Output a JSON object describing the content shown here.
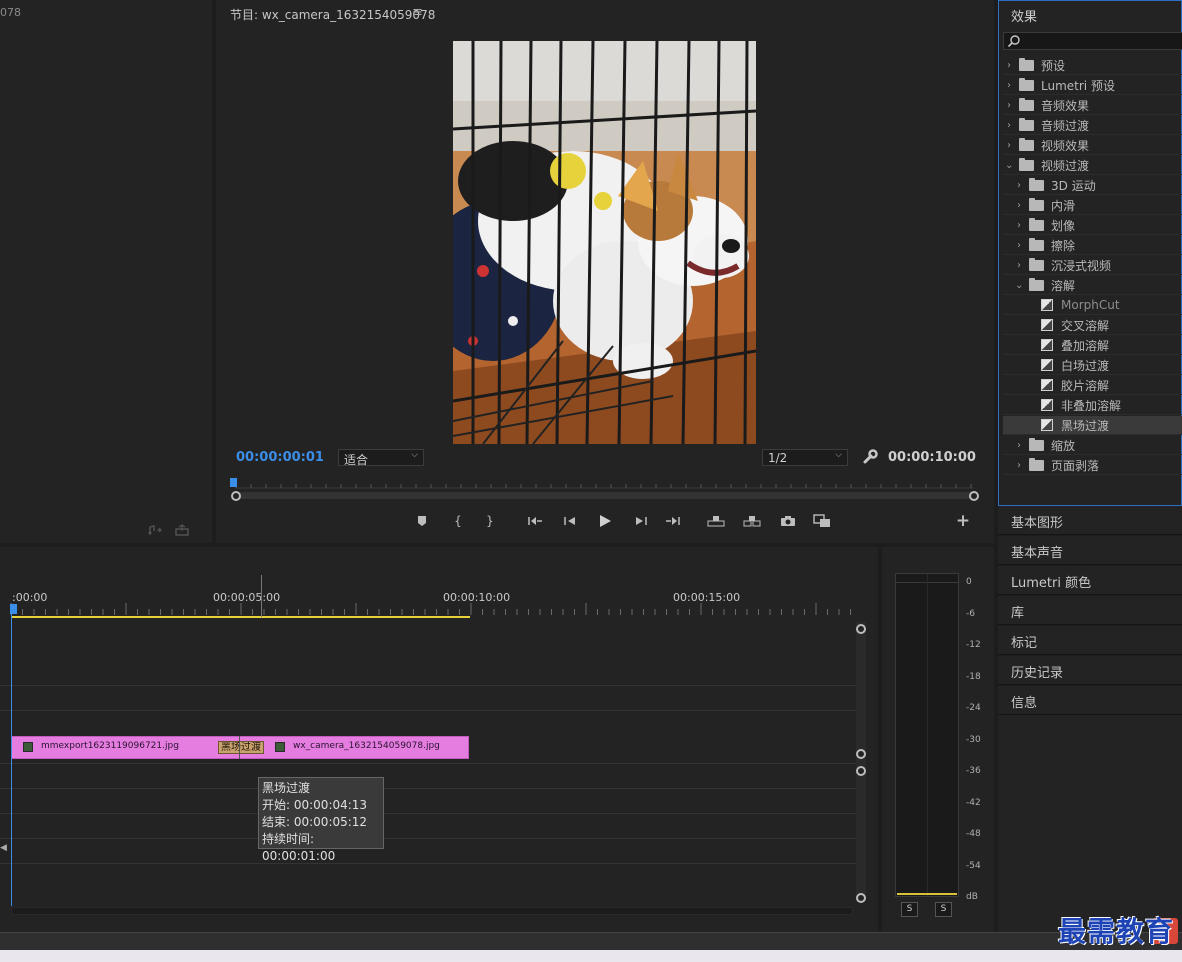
{
  "source_panel": {
    "title_fragment": "078"
  },
  "program_monitor": {
    "title": "节目: wx_camera_1632154059078",
    "menu_icon": "≡",
    "timecode_current": "00:00:00:01",
    "timecode_duration": "00:00:10:00",
    "fit_dropdown": "适合",
    "resolution_dropdown": "1/2",
    "accent_color": "#3b8ee8"
  },
  "effects_panel": {
    "title": "效果",
    "search_placeholder": "",
    "items": [
      {
        "label": "预设",
        "level": 0,
        "kind": "folder-preset",
        "expanded": false
      },
      {
        "label": "Lumetri 预设",
        "level": 0,
        "kind": "folder-preset",
        "expanded": false
      },
      {
        "label": "音频效果",
        "level": 0,
        "kind": "folder",
        "expanded": false
      },
      {
        "label": "音频过渡",
        "level": 0,
        "kind": "folder",
        "expanded": false
      },
      {
        "label": "视频效果",
        "level": 0,
        "kind": "folder",
        "expanded": false
      },
      {
        "label": "视频过渡",
        "level": 0,
        "kind": "folder",
        "expanded": true
      },
      {
        "label": "3D 运动",
        "level": 1,
        "kind": "folder",
        "expanded": false
      },
      {
        "label": "内滑",
        "level": 1,
        "kind": "folder",
        "expanded": false
      },
      {
        "label": "划像",
        "level": 1,
        "kind": "folder",
        "expanded": false
      },
      {
        "label": "擦除",
        "level": 1,
        "kind": "folder",
        "expanded": false
      },
      {
        "label": "沉浸式视频",
        "level": 1,
        "kind": "folder",
        "expanded": false
      },
      {
        "label": "溶解",
        "level": 1,
        "kind": "folder",
        "expanded": true
      },
      {
        "label": "MorphCut",
        "level": 2,
        "kind": "effect"
      },
      {
        "label": "交叉溶解",
        "level": 2,
        "kind": "effect"
      },
      {
        "label": "叠加溶解",
        "level": 2,
        "kind": "effect"
      },
      {
        "label": "白场过渡",
        "level": 2,
        "kind": "effect"
      },
      {
        "label": "胶片溶解",
        "level": 2,
        "kind": "effect"
      },
      {
        "label": "非叠加溶解",
        "level": 2,
        "kind": "effect"
      },
      {
        "label": "黑场过渡",
        "level": 2,
        "kind": "effect",
        "selected": true
      },
      {
        "label": "缩放",
        "level": 1,
        "kind": "folder",
        "expanded": false
      },
      {
        "label": "页面剥落",
        "level": 1,
        "kind": "folder",
        "expanded": false
      }
    ]
  },
  "right_panels": [
    "基本图形",
    "基本声音",
    "Lumetri 颜色",
    "库",
    "标记",
    "历史记录",
    "信息"
  ],
  "timeline": {
    "ruler_labels": [
      ":00:00",
      "00:00:05:00",
      "00:00:10:00",
      "00:00:15:00"
    ],
    "clip_a_name": "mmexport1623119096721.jpg",
    "clip_b_name": "wx_camera_1632154059078.jpg",
    "transition_label": "黑场过渡",
    "clip_color": "#e57ce0",
    "tooltip": {
      "title": "黑场过渡",
      "start": "开始: 00:00:04:13",
      "end": "结束: 00:00:05:12",
      "duration": "持续时间: 00:00:01:00"
    }
  },
  "audio_meter": {
    "db_labels": [
      "0",
      "-6",
      "-12",
      "-18",
      "-24",
      "-30",
      "-36",
      "-42",
      "-48",
      "-54",
      "dB"
    ],
    "solo_labels": [
      "S",
      "S"
    ]
  },
  "watermark": "最需教育"
}
